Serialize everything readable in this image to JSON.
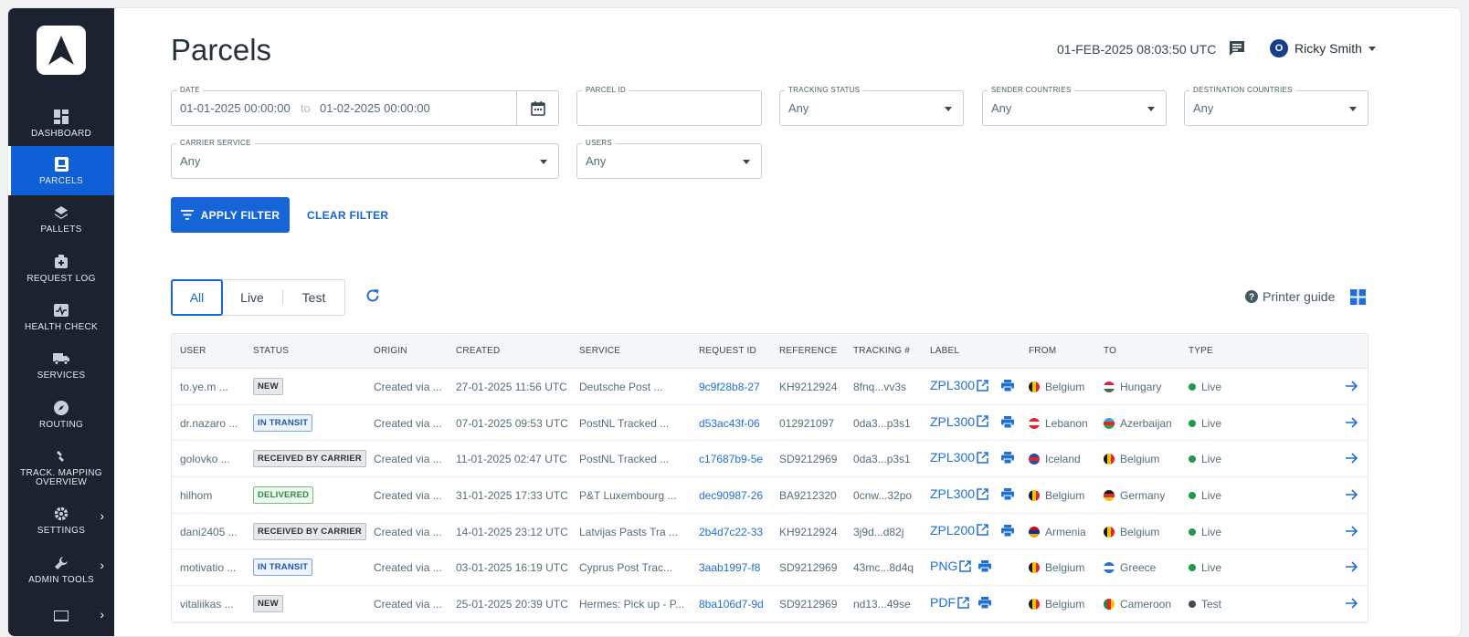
{
  "app": {
    "page_title": "Parcels",
    "clock": "01-FEB-2025 08:03:50 UTC",
    "user_name": "Ricky Smith",
    "user_initial": "O"
  },
  "sidebar": {
    "items": [
      {
        "label": "DASHBOARD",
        "icon": "dashboard-icon"
      },
      {
        "label": "PARCELS",
        "icon": "parcel-icon",
        "active": true
      },
      {
        "label": "PALLETS",
        "icon": "layers-icon"
      },
      {
        "label": "REQUEST LOG",
        "icon": "medical-bag-icon"
      },
      {
        "label": "HEALTH CHECK",
        "icon": "pulse-icon"
      },
      {
        "label": "SERVICES",
        "icon": "truck-icon"
      },
      {
        "label": "ROUTING",
        "icon": "compass-icon"
      },
      {
        "label": "TRACK. MAPPING OVERVIEW",
        "icon": "link-icon"
      },
      {
        "label": "SETTINGS",
        "icon": "gear-icon"
      },
      {
        "label": "ADMIN TOOLS",
        "icon": "wrench-icon"
      }
    ]
  },
  "filters": {
    "date": {
      "label": "DATE",
      "from": "01-01-2025 00:00:00",
      "sep": "to",
      "to": "01-02-2025 00:00:00"
    },
    "parcel_id": {
      "label": "PARCEL ID",
      "value": ""
    },
    "tracking_status": {
      "label": "TRACKING STATUS",
      "value": "Any"
    },
    "sender_countries": {
      "label": "SENDER COUNTRIES",
      "value": "Any"
    },
    "destination_countries": {
      "label": "DESTINATION COUNTRIES",
      "value": "Any"
    },
    "carrier_service": {
      "label": "CARRIER SERVICE",
      "value": "Any"
    },
    "users": {
      "label": "USERS",
      "value": "Any"
    },
    "apply_label": "APPLY FILTER",
    "clear_label": "CLEAR FILTER"
  },
  "tabs": {
    "all": "All",
    "live": "Live",
    "test": "Test"
  },
  "toolbar": {
    "printer_guide": "Printer guide"
  },
  "table": {
    "columns": [
      "USER",
      "STATUS",
      "ORIGIN",
      "CREATED",
      "SERVICE",
      "REQUEST ID",
      "REFERENCE",
      "TRACKING #",
      "LABEL",
      "FROM",
      "TO",
      "TYPE"
    ],
    "rows": [
      {
        "user": "to.ye.m ...",
        "status": "NEW",
        "status_kind": "new",
        "origin": "Created via ...",
        "created": "27-01-2025 11:56 UTC",
        "service": "Deutsche Post ...",
        "request_id": "9c9f28b8-27",
        "reference": "KH9212924",
        "tracking": "8fnq...vv3s",
        "label": "ZPL300",
        "from": "Belgium",
        "to": "Hungary",
        "type": "Live"
      },
      {
        "user": "dr.nazaro ...",
        "status": "IN TRANSIT",
        "status_kind": "transit",
        "origin": "Created via ...",
        "created": "07-01-2025 09:53 UTC",
        "service": "PostNL Tracked ...",
        "request_id": "d53ac43f-06",
        "reference": "012921097",
        "tracking": "0da3...p3s1",
        "label": "ZPL300",
        "from": "Lebanon",
        "to": "Azerbaijan",
        "type": "Live"
      },
      {
        "user": "golovko ...",
        "status": "RECEIVED BY CARRIER",
        "status_kind": "carrier",
        "origin": "Created via ...",
        "created": "11-01-2025 02:47 UTC",
        "service": "PostNL Tracked ...",
        "request_id": "c17687b9-5e",
        "reference": "SD9212969",
        "tracking": "0da3...p3s1",
        "label": "ZPL300",
        "from": "Iceland",
        "to": "Belgium",
        "type": "Live"
      },
      {
        "user": "hilhom",
        "status": "DELIVERED",
        "status_kind": "delivered",
        "origin": "Created via ...",
        "created": "31-01-2025 17:33 UTC",
        "service": "P&T Luxembourg ...",
        "request_id": "dec90987-26",
        "reference": "BA9212320",
        "tracking": "0cnw...32po",
        "label": "ZPL300",
        "from": "Belgium",
        "to": "Germany",
        "type": "Live"
      },
      {
        "user": "dani2405 ...",
        "status": "RECEIVED BY CARRIER",
        "status_kind": "carrier",
        "origin": "Created via ...",
        "created": "14-01-2025 23:12 UTC",
        "service": "Latvijas Pasts Tra ...",
        "request_id": "2b4d7c22-33",
        "reference": "KH9212924",
        "tracking": "3j9d...d82j",
        "label": "ZPL200",
        "from": "Armenia",
        "to": "Belgium",
        "type": "Live"
      },
      {
        "user": "motivatio ...",
        "status": "IN TRANSIT",
        "status_kind": "transit",
        "origin": "Created via ...",
        "created": "03-01-2025 16:19 UTC",
        "service": "Cyprus Post Trac...",
        "request_id": "3aab1997-f8",
        "reference": "SD9212969",
        "tracking": "43mc...8d4q",
        "label": "PNG",
        "from": "Belgium",
        "to": "Greece",
        "type": "Live"
      },
      {
        "user": "vitaliikas ...",
        "status": "NEW",
        "status_kind": "new",
        "origin": "Created via ...",
        "created": "25-01-2025 20:39 UTC",
        "service": "Hermes: Pick up - P...",
        "request_id": "8ba106d7-9d",
        "reference": "SD9212969",
        "tracking": "nd13...49se",
        "label": "PDF",
        "from": "Belgium",
        "to": "Cameroon",
        "type": "Test"
      }
    ]
  },
  "colors": {
    "accent": "#1565d8",
    "sidebar": "#1d2230",
    "live": "#1e9a4a",
    "test": "#424a53"
  }
}
